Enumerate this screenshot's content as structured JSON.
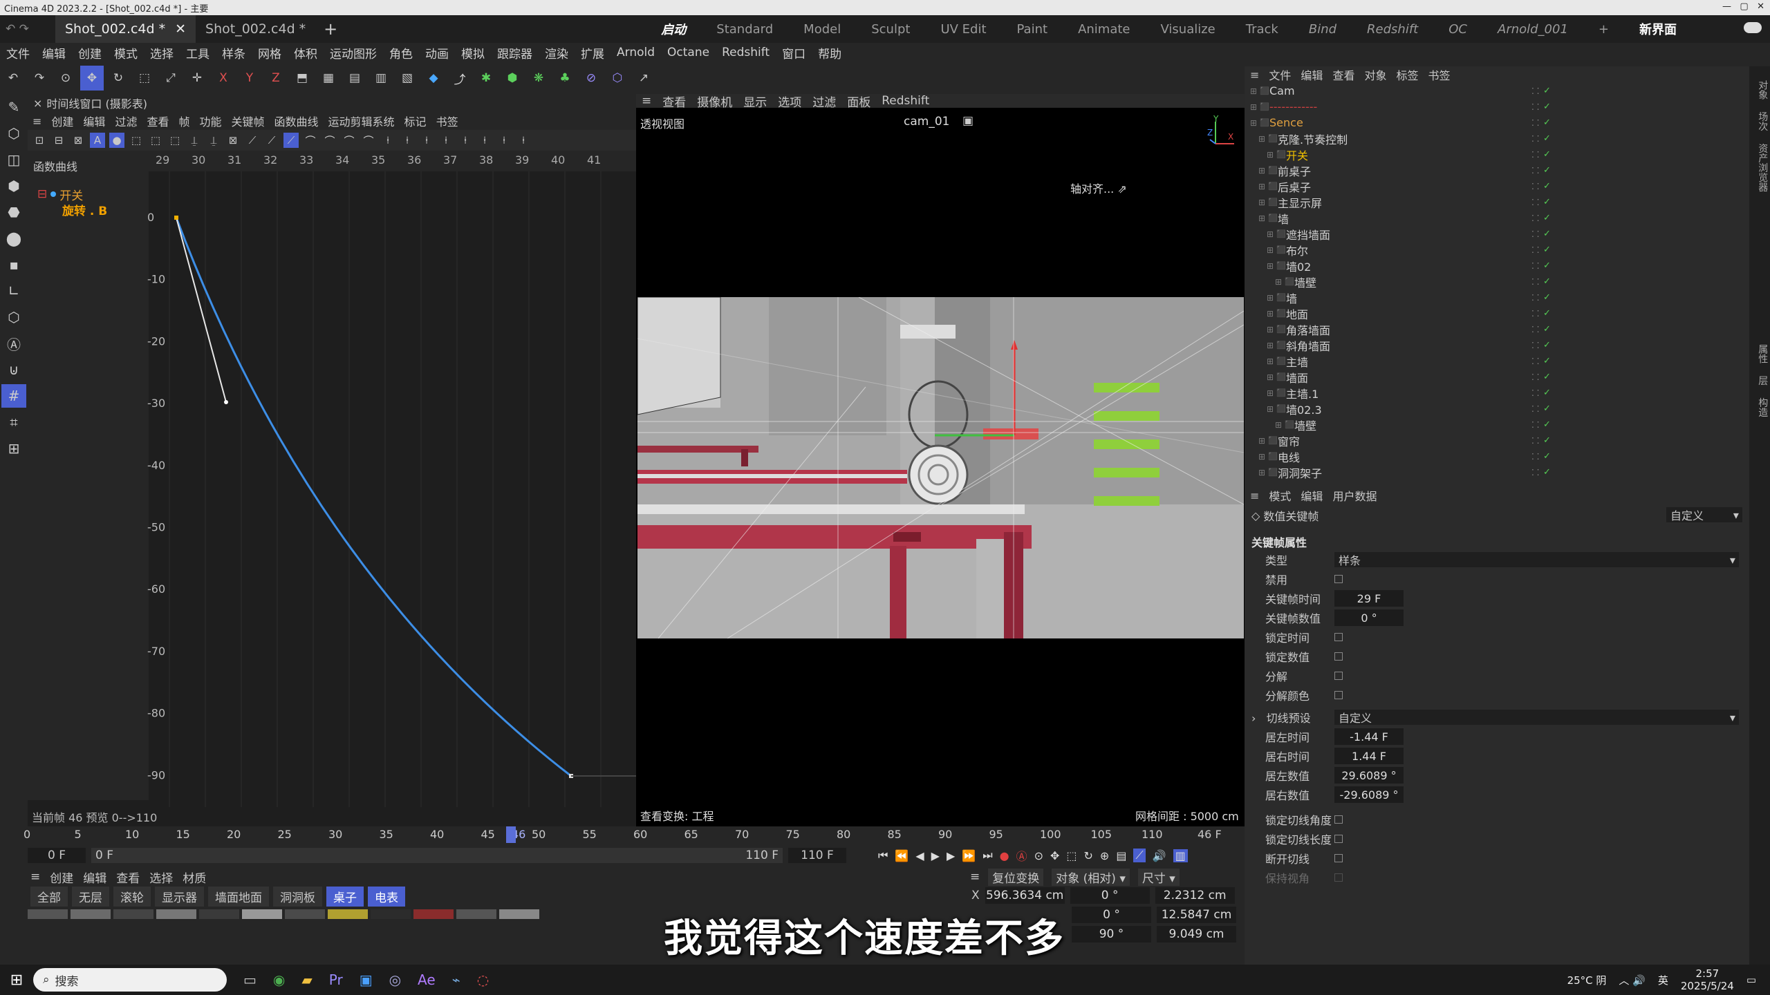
{
  "window": {
    "title": "Cinema 4D 2023.2.2 - [Shot_002.c4d *] - 主要"
  },
  "tabs": {
    "doc1": "Shot_002.c4d *",
    "doc2": "Shot_002.c4d *",
    "add": "+"
  },
  "layouts": [
    "启动",
    "Standard",
    "Model",
    "Sculpt",
    "UV Edit",
    "Paint",
    "Animate",
    "Visualize",
    "Track",
    "Bind",
    "Redshift",
    "OC",
    "Arnold_001",
    "+",
    "新界面"
  ],
  "menu": [
    "文件",
    "编辑",
    "创建",
    "模式",
    "选择",
    "工具",
    "样条",
    "网格",
    "体积",
    "运动图形",
    "角色",
    "动画",
    "模拟",
    "跟踪器",
    "渲染",
    "扩展",
    "Arnold",
    "Octane",
    "Redshift",
    "窗口",
    "帮助"
  ],
  "timeline": {
    "title": "时间线窗口 (摄影表)",
    "menu": [
      "创建",
      "编辑",
      "过滤",
      "查看",
      "帧",
      "功能",
      "关键帧",
      "函数曲线",
      "运动剪辑系统",
      "标记",
      "书签"
    ],
    "curves_label": "函数曲线",
    "track1": "开关",
    "track2": "旋转 . B",
    "ruler": [
      "29",
      "30",
      "31",
      "32",
      "33",
      "34",
      "35",
      "36",
      "37",
      "38",
      "39",
      "40",
      "41"
    ],
    "yticks": [
      "0",
      "-10",
      "-20",
      "-30",
      "-40",
      "-50",
      "-60",
      "-70",
      "-80",
      "-90"
    ],
    "status": "当前帧  46  预览  0-->110"
  },
  "viewport": {
    "menu": [
      "查看",
      "摄像机",
      "显示",
      "选项",
      "过滤",
      "面板",
      "Redshift"
    ],
    "view_name": "透视视图",
    "camera": "cam_01",
    "axis_align": "轴对齐...",
    "transform": "查看变换: 工程",
    "grid": "网格间距 : 5000 cm"
  },
  "objects": {
    "menu": [
      "文件",
      "编辑",
      "查看",
      "对象",
      "标签",
      "书签"
    ],
    "items": [
      {
        "name": "Cam",
        "indent": 0,
        "color": "#d0d0d0"
      },
      {
        "name": "------------",
        "indent": 0,
        "color": "#d04040"
      },
      {
        "name": "Sence",
        "indent": 0,
        "color": "#e0a040"
      },
      {
        "name": "克隆.节奏控制",
        "indent": 1,
        "color": "#d0d0d0"
      },
      {
        "name": "开关",
        "indent": 2,
        "color": "#f0c000"
      },
      {
        "name": "前桌子",
        "indent": 1,
        "color": "#d0d0d0"
      },
      {
        "name": "后桌子",
        "indent": 1,
        "color": "#d0d0d0"
      },
      {
        "name": "主显示屏",
        "indent": 1,
        "color": "#d0d0d0"
      },
      {
        "name": "墙",
        "indent": 1,
        "color": "#d0d0d0"
      },
      {
        "name": "遮挡墙面",
        "indent": 2,
        "color": "#d0d0d0"
      },
      {
        "name": "布尔",
        "indent": 2,
        "color": "#d0d0d0"
      },
      {
        "name": "墙02",
        "indent": 2,
        "color": "#d0d0d0"
      },
      {
        "name": "墙壁",
        "indent": 3,
        "color": "#d0d0d0"
      },
      {
        "name": "墙",
        "indent": 2,
        "color": "#d0d0d0"
      },
      {
        "name": "地面",
        "indent": 2,
        "color": "#d0d0d0"
      },
      {
        "name": "角落墙面",
        "indent": 2,
        "color": "#d0d0d0"
      },
      {
        "name": "斜角墙面",
        "indent": 2,
        "color": "#d0d0d0"
      },
      {
        "name": "主墙",
        "indent": 2,
        "color": "#d0d0d0"
      },
      {
        "name": "墙面",
        "indent": 2,
        "color": "#d0d0d0"
      },
      {
        "name": "主墙.1",
        "indent": 2,
        "color": "#d0d0d0"
      },
      {
        "name": "墙02.3",
        "indent": 2,
        "color": "#d0d0d0"
      },
      {
        "name": "墙壁",
        "indent": 3,
        "color": "#d0d0d0"
      },
      {
        "name": "窗帘",
        "indent": 1,
        "color": "#d0d0d0"
      },
      {
        "name": "电线",
        "indent": 1,
        "color": "#d0d0d0"
      },
      {
        "name": "洞洞架子",
        "indent": 1,
        "color": "#d0d0d0"
      }
    ]
  },
  "attributes": {
    "menu": [
      "模式",
      "编辑",
      "用户数据"
    ],
    "section": "数值关键帧",
    "preset": "自定义",
    "group": "关键帧属性",
    "type_label": "类型",
    "type_value": "样条",
    "disable": "禁用",
    "key_time_label": "关键帧时间",
    "key_time": "29 F",
    "key_value_label": "关键帧数值",
    "key_value": "0 °",
    "lock_time": "锁定时间",
    "lock_value": "锁定数值",
    "break": "分解",
    "break_color": "分解颜色",
    "tangent_preset_label": "切线预设",
    "tangent_preset": "自定义",
    "left_time_label": "居左时间",
    "left_time": "-1.44 F",
    "right_time_label": "居右时间",
    "right_time": "1.44 F",
    "left_value_label": "居左数值",
    "left_value": "29.6089 °",
    "right_value_label": "居右数值",
    "right_value": "-29.6089 °",
    "lock_tangent_angle": "锁定切线角度",
    "lock_tangent_length": "锁定切线长度",
    "break_tangent": "断开切线",
    "keep_visual": "保持视角"
  },
  "playback": {
    "ruler": [
      "0",
      "5",
      "10",
      "15",
      "20",
      "25",
      "30",
      "35",
      "40",
      "45",
      "50",
      "55",
      "60",
      "65",
      "70",
      "75",
      "80",
      "85",
      "90",
      "95",
      "100",
      "105",
      "110"
    ],
    "current_marker": "46",
    "end_label": "46 F",
    "start_field": "0 F",
    "min_field": "0 F",
    "max_field": "110 F",
    "end_field": "110 F"
  },
  "materials": {
    "menu": [
      "创建",
      "编辑",
      "查看",
      "选择",
      "材质"
    ],
    "filters": [
      "全部",
      "无层",
      "滚轮",
      "显示器",
      "墙面地面",
      "洞洞板",
      "桌子",
      "电表"
    ]
  },
  "coords": {
    "reset": "复位变换",
    "mode": "对象 (相对)",
    "size": "尺寸",
    "x_label": "X",
    "x_pos": "596.3634 cm",
    "x_rot": "0 °",
    "x_size": "2.2312 cm",
    "y_rot": "0 °",
    "y_size": "12.5847 cm",
    "z_rot": "90 °",
    "z_size": "9.049 cm"
  },
  "subtitle": "我觉得这个速度差不多",
  "taskbar": {
    "search": "搜索",
    "temp": "25°C 阴",
    "ime": "英",
    "time": "2:57",
    "date": "2025/5/24"
  }
}
